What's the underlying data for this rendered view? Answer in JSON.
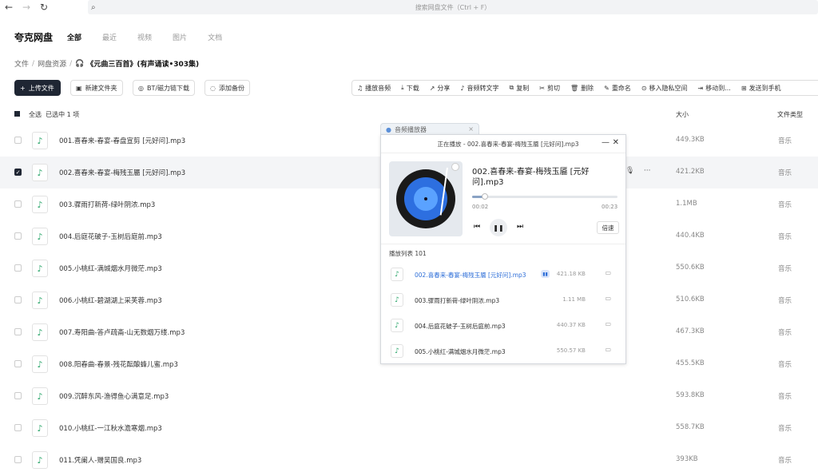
{
  "topbar": {
    "search_placeholder": "搜索网盘文件（Ctrl + F）"
  },
  "header": {
    "logo": "夸克网盘",
    "tabs": [
      {
        "label": "全部",
        "active": true
      },
      {
        "label": "最近",
        "active": false
      },
      {
        "label": "视频",
        "active": false
      },
      {
        "label": "图片",
        "active": false
      },
      {
        "label": "文档",
        "active": false
      }
    ]
  },
  "breadcrumb": {
    "items": [
      "文件",
      "网盘资源"
    ],
    "current": "《元曲三百首》(有声诵读•303集)"
  },
  "toolbar": {
    "upload": "上传文件",
    "new_folder": "新建文件夹",
    "bt_download": "BT/磁力链下载",
    "add_backup": "添加备份",
    "actions": [
      "播放音频",
      "下载",
      "分享",
      "音频转文字",
      "复制",
      "剪切",
      "删除",
      "重命名",
      "移入隐私空间",
      "移动到...",
      "发送到手机"
    ]
  },
  "list_header": {
    "select_all": "全选",
    "selected": "已选中 1 项",
    "col_size": "大小",
    "col_type": "文件类型"
  },
  "files": [
    {
      "name": "001.喜春来-春宴-春盘宣剪 [元好问].mp3",
      "size": "449.3KB",
      "type": "音乐",
      "selected": false
    },
    {
      "name": "002.喜春来-春宴-梅残玉靥 [元好问].mp3",
      "size": "421.2KB",
      "type": "音乐",
      "selected": true
    },
    {
      "name": "003.骤雨打新荷-绿叶阴浓.mp3",
      "size": "1.1MB",
      "type": "音乐",
      "selected": false
    },
    {
      "name": "004.后庭花破子-玉树后庭前.mp3",
      "size": "440.4KB",
      "type": "音乐",
      "selected": false
    },
    {
      "name": "005.小桃红-满城烟水月微茫.mp3",
      "size": "550.6KB",
      "type": "音乐",
      "selected": false
    },
    {
      "name": "006.小桃红-碧湖湖上采芙蓉.mp3",
      "size": "510.6KB",
      "type": "音乐",
      "selected": false
    },
    {
      "name": "007.寿阳曲-答卢疏斋-山无数烟万缕.mp3",
      "size": "467.3KB",
      "type": "音乐",
      "selected": false
    },
    {
      "name": "008.阳春曲-春景-残花酝酿蜂儿蜜.mp3",
      "size": "455.5KB",
      "type": "音乐",
      "selected": false
    },
    {
      "name": "009.沉醉东风-渔得鱼心满意足.mp3",
      "size": "593.8KB",
      "type": "音乐",
      "selected": false
    },
    {
      "name": "010.小桃红-一江秋水澹寒烟.mp3",
      "size": "558.7KB",
      "type": "音乐",
      "selected": false
    },
    {
      "name": "011.凭阑人-赠吴国良.mp3",
      "size": "393KB",
      "type": "音乐",
      "selected": false
    }
  ],
  "player": {
    "tab_label": "音频播放器",
    "title": "正在播放 - 002.喜春来-春宴-梅残玉靥 [元好问].mp3",
    "song": "002.喜春来-春宴-梅残玉靥 [元好问].mp3",
    "time_current": "00:02",
    "time_total": "00:23",
    "progress": 0.09,
    "speed": "倍速",
    "playlist_label": "播放列表  101",
    "playlist": [
      {
        "name": "002.喜春来-春宴-梅残玉靥 [元好问].mp3",
        "size": "421.18 KB",
        "playing": true
      },
      {
        "name": "003.骤雨打新荷-绿叶阴浓.mp3",
        "size": "1.11 MB",
        "playing": false
      },
      {
        "name": "004.后庭花破子-玉树后庭前.mp3",
        "size": "440.37 KB",
        "playing": false
      },
      {
        "name": "005.小桃红-满城烟水月微茫.mp3",
        "size": "550.57 KB",
        "playing": false
      }
    ]
  },
  "colors": {
    "accent": "#2f6fd8",
    "primary_button": "#1f2633",
    "music_icon": "#2aa56a"
  }
}
